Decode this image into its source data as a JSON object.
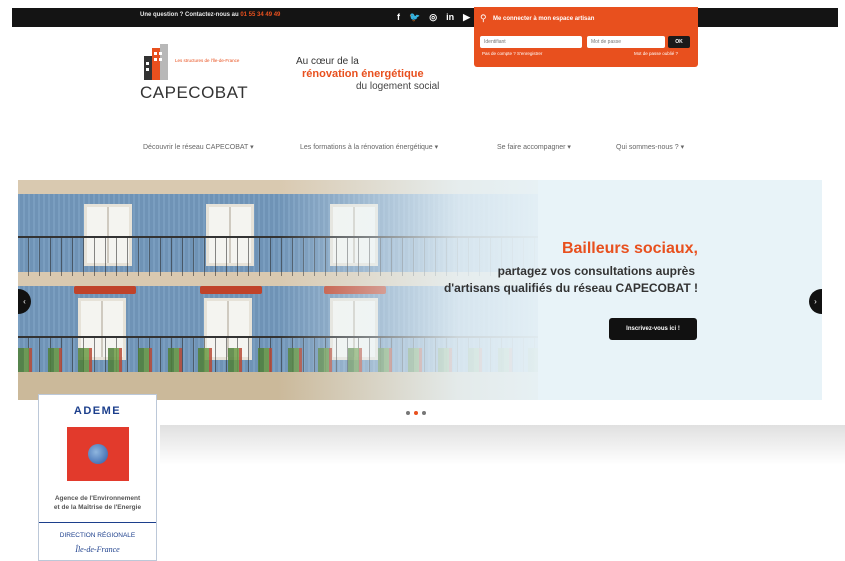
{
  "topbar": {
    "question": "Une question ? Contactez-nous au ",
    "phone": "01 55 34 49 49",
    "socials": [
      "f",
      "🐦",
      "◎",
      "in",
      "▶"
    ]
  },
  "login": {
    "title": "Me connecter à mon espace artisan",
    "id_placeholder": "Identifiant",
    "password_placeholder": "Mot de passe",
    "ok_label": "OK",
    "no_account": "Pas de compte ? S'enregistrer",
    "forgot": "Mot de passe oublié ?"
  },
  "logo": {
    "small_text": "Les structures de l'Île-de-France",
    "name": "CAPECOBAT"
  },
  "tagline": {
    "line1": "Au cœur de la",
    "line2": "rénovation énergétique",
    "line3": "du logement social"
  },
  "nav": [
    "Découvrir le réseau CAPECOBAT ▾",
    "Les formations à la rénovation énergétique ▾",
    "Se faire accompagner ▾",
    "Qui sommes-nous ? ▾"
  ],
  "slide": {
    "title": "Bailleurs sociaux,",
    "sub1": "partagez vos consultations auprès",
    "sub2": "d'artisans qualifiés du réseau CAPECOBAT !",
    "button": "Inscrivez-vous ici !"
  },
  "arrows": {
    "prev": "‹",
    "next": "›"
  },
  "ademe": {
    "name": "ADEME",
    "agency_line1": "Agence de l'Environnement",
    "agency_line2": "et de la Maîtrise de l'Energie",
    "direction": "DIRECTION RÉGIONALE",
    "region": "Île-de-France"
  },
  "colors": {
    "accent": "#e8501e",
    "dark": "#141414",
    "ademe_blue": "#1c3f8c",
    "ademe_red": "#e23a2c"
  }
}
